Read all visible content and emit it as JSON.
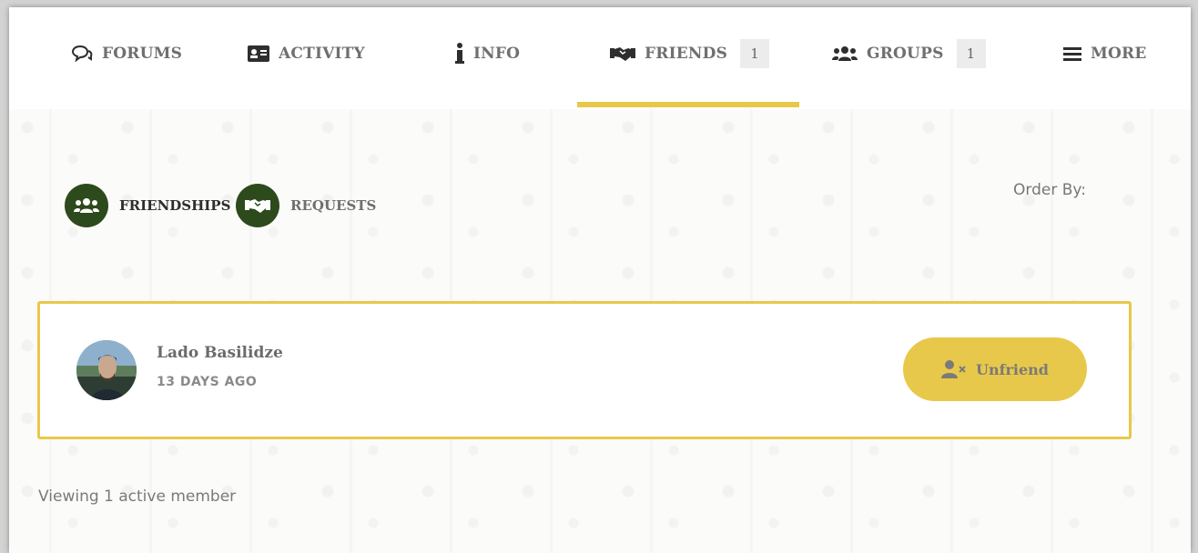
{
  "nav": {
    "items": [
      {
        "label": "FORUMS",
        "icon": "chat-bubbles-icon"
      },
      {
        "label": "ACTIVITY",
        "icon": "id-card-icon"
      },
      {
        "label": "INFO",
        "icon": "info-icon"
      },
      {
        "label": "FRIENDS",
        "icon": "handshake-icon",
        "count": "1",
        "active": true
      },
      {
        "label": "GROUPS",
        "icon": "users-icon",
        "count": "1"
      },
      {
        "label": "MORE",
        "icon": "menu-icon"
      }
    ]
  },
  "subnav": {
    "friendships_label": "FRIENDSHIPS",
    "requests_label": "REQUESTS",
    "order_by_label": "Order By:"
  },
  "member": {
    "name": "Lado Basilidze",
    "time": "13 DAYS AGO",
    "unfriend_label": "Unfriend"
  },
  "footer": {
    "viewing": "Viewing 1 active member"
  },
  "colors": {
    "accent": "#e8c84a",
    "dark_green": "#2d4a1c",
    "text_gray": "#6f6f6f"
  }
}
